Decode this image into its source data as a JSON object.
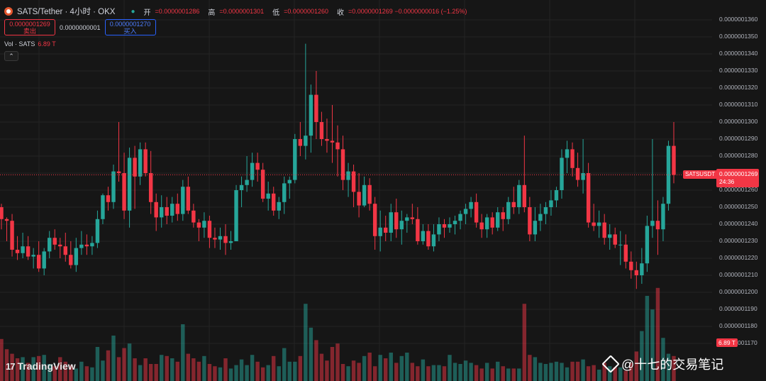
{
  "header": {
    "symbol_title": "SATS/Tether · 4小时 · OKX",
    "live_icon": "circle-dot-icon",
    "ohlc": [
      {
        "label": "开",
        "value": "=0.0000001286"
      },
      {
        "label": "高",
        "value": "=0.0000001301"
      },
      {
        "label": "低",
        "value": "=0.0000001260"
      },
      {
        "label": "收",
        "value": "=0.0000001269 −0.0000000016 (−1.25%)"
      }
    ]
  },
  "trade": {
    "sell_price": "0.0000001269",
    "sell_label": "卖出",
    "spread": "0.0000000001",
    "buy_price": "0.0000001270",
    "buy_label": "买入"
  },
  "volume_legend": {
    "label": "Vol · SATS",
    "value": "6.89 T"
  },
  "collapse_icon": "chevron-up-icon",
  "price_tag": {
    "symbol": "SATSUSDT",
    "price": "0.0000001269",
    "countdown": "24:36"
  },
  "volume_tag": "6.89 T",
  "price_axis": {
    "ticks": [
      "0.0000001360",
      "0.0000001350",
      "0.0000001340",
      "0.0000001330",
      "0.0000001320",
      "0.0000001310",
      "0.0000001300",
      "0.0000001290",
      "0.0000001280",
      "0.0000001270",
      "0.0000001260",
      "0.0000001250",
      "0.0000001240",
      "0.0000001230",
      "0.0000001220",
      "0.0000001210",
      "0.0000001200",
      "0.0000001190",
      "0.0000001180",
      "0.0000001170"
    ]
  },
  "branding": {
    "tv_logo": "TradingView",
    "watermark": "@十七的交易笔记"
  },
  "colors": {
    "up": "#26a69a",
    "down": "#f23645",
    "bg": "#161616",
    "grid": "#242424"
  },
  "chart_data": {
    "type": "candlestick",
    "ylim": [
      1.165,
      1.365
    ],
    "y_unit": "1e-7",
    "candles": [
      [
        1.25,
        1.252,
        1.237,
        1.243
      ],
      [
        1.243,
        1.244,
        1.23,
        1.242
      ],
      [
        1.242,
        1.246,
        1.221,
        1.225
      ],
      [
        1.225,
        1.233,
        1.219,
        1.223
      ],
      [
        1.223,
        1.235,
        1.22,
        1.227
      ],
      [
        1.227,
        1.233,
        1.219,
        1.221
      ],
      [
        1.221,
        1.226,
        1.214,
        1.222
      ],
      [
        1.222,
        1.23,
        1.212,
        1.214
      ],
      [
        1.214,
        1.226,
        1.21,
        1.224
      ],
      [
        1.224,
        1.236,
        1.22,
        1.232
      ],
      [
        1.232,
        1.237,
        1.225,
        1.228
      ],
      [
        1.228,
        1.232,
        1.22,
        1.227
      ],
      [
        1.227,
        1.235,
        1.218,
        1.222
      ],
      [
        1.222,
        1.23,
        1.214,
        1.216
      ],
      [
        1.216,
        1.232,
        1.212,
        1.226
      ],
      [
        1.226,
        1.236,
        1.222,
        1.228
      ],
      [
        1.228,
        1.234,
        1.222,
        1.227
      ],
      [
        1.227,
        1.233,
        1.222,
        1.229
      ],
      [
        1.229,
        1.248,
        1.226,
        1.243
      ],
      [
        1.243,
        1.258,
        1.24,
        1.257
      ],
      [
        1.257,
        1.262,
        1.248,
        1.253
      ],
      [
        1.253,
        1.275,
        1.249,
        1.271
      ],
      [
        1.271,
        1.3,
        1.265,
        1.27
      ],
      [
        1.27,
        1.282,
        1.243,
        1.248
      ],
      [
        1.248,
        1.285,
        1.238,
        1.279
      ],
      [
        1.279,
        1.286,
        1.249,
        1.268
      ],
      [
        1.268,
        1.288,
        1.263,
        1.284
      ],
      [
        1.284,
        1.288,
        1.268,
        1.27
      ],
      [
        1.27,
        1.283,
        1.246,
        1.253
      ],
      [
        1.253,
        1.258,
        1.236,
        1.244
      ],
      [
        1.244,
        1.257,
        1.238,
        1.25
      ],
      [
        1.25,
        1.256,
        1.24,
        1.245
      ],
      [
        1.245,
        1.256,
        1.241,
        1.252
      ],
      [
        1.252,
        1.258,
        1.242,
        1.246
      ],
      [
        1.246,
        1.266,
        1.242,
        1.262
      ],
      [
        1.262,
        1.268,
        1.246,
        1.248
      ],
      [
        1.248,
        1.252,
        1.238,
        1.241
      ],
      [
        1.241,
        1.243,
        1.23,
        1.238
      ],
      [
        1.238,
        1.247,
        1.232,
        1.242
      ],
      [
        1.242,
        1.245,
        1.226,
        1.232
      ],
      [
        1.232,
        1.238,
        1.226,
        1.231
      ],
      [
        1.231,
        1.238,
        1.225,
        1.233
      ],
      [
        1.233,
        1.24,
        1.222,
        1.229
      ],
      [
        1.229,
        1.236,
        1.225,
        1.23
      ],
      [
        1.23,
        1.263,
        1.23,
        1.26
      ],
      [
        1.26,
        1.268,
        1.25,
        1.263
      ],
      [
        1.263,
        1.28,
        1.259,
        1.266
      ],
      [
        1.266,
        1.282,
        1.262,
        1.276
      ],
      [
        1.276,
        1.282,
        1.265,
        1.272
      ],
      [
        1.272,
        1.276,
        1.253,
        1.255
      ],
      [
        1.255,
        1.265,
        1.248,
        1.258
      ],
      [
        1.258,
        1.262,
        1.245,
        1.248
      ],
      [
        1.248,
        1.256,
        1.243,
        1.253
      ],
      [
        1.253,
        1.268,
        1.246,
        1.264
      ],
      [
        1.264,
        1.268,
        1.255,
        1.266
      ],
      [
        1.266,
        1.293,
        1.264,
        1.29
      ],
      [
        1.29,
        1.3,
        1.28,
        1.286
      ],
      [
        1.286,
        1.346,
        1.278,
        1.292
      ],
      [
        1.292,
        1.322,
        1.282,
        1.316
      ],
      [
        1.316,
        1.33,
        1.29,
        1.3
      ],
      [
        1.3,
        1.306,
        1.286,
        1.29
      ],
      [
        1.29,
        1.302,
        1.282,
        1.289
      ],
      [
        1.289,
        1.31,
        1.276,
        1.288
      ],
      [
        1.288,
        1.298,
        1.268,
        1.284
      ],
      [
        1.284,
        1.292,
        1.26,
        1.266
      ],
      [
        1.266,
        1.276,
        1.256,
        1.271
      ],
      [
        1.271,
        1.275,
        1.25,
        1.259
      ],
      [
        1.259,
        1.27,
        1.244,
        1.251
      ],
      [
        1.251,
        1.268,
        1.25,
        1.263
      ],
      [
        1.263,
        1.267,
        1.248,
        1.252
      ],
      [
        1.252,
        1.256,
        1.225,
        1.233
      ],
      [
        1.233,
        1.248,
        1.224,
        1.238
      ],
      [
        1.238,
        1.245,
        1.23,
        1.235
      ],
      [
        1.235,
        1.252,
        1.23,
        1.247
      ],
      [
        1.247,
        1.255,
        1.232,
        1.237
      ],
      [
        1.237,
        1.248,
        1.228,
        1.242
      ],
      [
        1.242,
        1.246,
        1.235,
        1.244
      ],
      [
        1.244,
        1.252,
        1.24,
        1.243
      ],
      [
        1.243,
        1.25,
        1.228,
        1.23
      ],
      [
        1.23,
        1.24,
        1.228,
        1.236
      ],
      [
        1.236,
        1.24,
        1.225,
        1.227
      ],
      [
        1.227,
        1.24,
        1.224,
        1.234
      ],
      [
        1.234,
        1.244,
        1.23,
        1.24
      ],
      [
        1.24,
        1.243,
        1.232,
        1.238
      ],
      [
        1.238,
        1.244,
        1.235,
        1.24
      ],
      [
        1.24,
        1.245,
        1.234,
        1.242
      ],
      [
        1.242,
        1.248,
        1.237,
        1.246
      ],
      [
        1.246,
        1.252,
        1.24,
        1.249
      ],
      [
        1.249,
        1.256,
        1.244,
        1.253
      ],
      [
        1.253,
        1.258,
        1.238,
        1.241
      ],
      [
        1.241,
        1.246,
        1.232,
        1.237
      ],
      [
        1.237,
        1.246,
        1.232,
        1.244
      ],
      [
        1.244,
        1.247,
        1.234,
        1.238
      ],
      [
        1.238,
        1.25,
        1.236,
        1.247
      ],
      [
        1.247,
        1.25,
        1.236,
        1.243
      ],
      [
        1.243,
        1.256,
        1.24,
        1.253
      ],
      [
        1.253,
        1.262,
        1.246,
        1.25
      ],
      [
        1.25,
        1.266,
        1.246,
        1.263
      ],
      [
        1.263,
        1.292,
        1.247,
        1.25
      ],
      [
        1.25,
        1.256,
        1.23,
        1.234
      ],
      [
        1.234,
        1.25,
        1.23,
        1.242
      ],
      [
        1.242,
        1.252,
        1.236,
        1.246
      ],
      [
        1.246,
        1.253,
        1.24,
        1.25
      ],
      [
        1.25,
        1.26,
        1.245,
        1.254
      ],
      [
        1.254,
        1.262,
        1.25,
        1.26
      ],
      [
        1.26,
        1.284,
        1.255,
        1.279
      ],
      [
        1.279,
        1.289,
        1.27,
        1.284
      ],
      [
        1.284,
        1.288,
        1.268,
        1.273
      ],
      [
        1.273,
        1.282,
        1.262,
        1.266
      ],
      [
        1.266,
        1.29,
        1.258,
        1.27
      ],
      [
        1.27,
        1.276,
        1.238,
        1.241
      ],
      [
        1.241,
        1.252,
        1.236,
        1.239
      ],
      [
        1.239,
        1.248,
        1.232,
        1.241
      ],
      [
        1.241,
        1.246,
        1.228,
        1.232
      ],
      [
        1.232,
        1.24,
        1.225,
        1.234
      ],
      [
        1.234,
        1.238,
        1.226,
        1.228
      ],
      [
        1.228,
        1.236,
        1.216,
        1.228
      ],
      [
        1.228,
        1.234,
        1.214,
        1.218
      ],
      [
        1.218,
        1.224,
        1.208,
        1.213
      ],
      [
        1.213,
        1.218,
        1.202,
        1.21
      ],
      [
        1.21,
        1.226,
        1.205,
        1.217
      ],
      [
        1.217,
        1.245,
        1.212,
        1.239
      ],
      [
        1.239,
        1.29,
        1.232,
        1.242
      ],
      [
        1.242,
        1.254,
        1.222,
        1.237
      ],
      [
        1.237,
        1.256,
        1.23,
        1.252
      ],
      [
        1.252,
        1.289,
        1.248,
        1.286
      ],
      [
        1.286,
        1.3,
        1.264,
        1.269
      ]
    ],
    "volume_max": 1.0,
    "volumes": [
      0.37,
      0.28,
      0.24,
      0.2,
      0.21,
      0.16,
      0.21,
      0.22,
      0.23,
      0.15,
      0.13,
      0.21,
      0.17,
      0.14,
      0.11,
      0.17,
      0.13,
      0.12,
      0.3,
      0.18,
      0.27,
      0.4,
      0.21,
      0.29,
      0.33,
      0.2,
      0.14,
      0.2,
      0.15,
      0.15,
      0.23,
      0.22,
      0.2,
      0.17,
      0.5,
      0.24,
      0.2,
      0.17,
      0.22,
      0.15,
      0.13,
      0.12,
      0.2,
      0.11,
      0.14,
      0.19,
      0.14,
      0.23,
      0.17,
      0.12,
      0.14,
      0.22,
      0.13,
      0.29,
      0.17,
      0.17,
      0.22,
      0.68,
      0.47,
      0.36,
      0.24,
      0.18,
      0.3,
      0.33,
      0.15,
      0.13,
      0.18,
      0.16,
      0.22,
      0.25,
      0.13,
      0.23,
      0.2,
      0.25,
      0.16,
      0.22,
      0.25,
      0.16,
      0.13,
      0.19,
      0.13,
      0.14,
      0.14,
      0.13,
      0.23,
      0.16,
      0.15,
      0.18,
      0.16,
      0.14,
      0.11,
      0.16,
      0.11,
      0.17,
      0.13,
      0.11,
      0.11,
      0.11,
      0.68,
      0.23,
      0.21,
      0.16,
      0.15,
      0.16,
      0.17,
      0.16,
      0.12,
      0.17,
      0.17,
      0.19,
      0.13,
      0.14,
      0.1,
      0.16,
      0.13,
      0.12,
      0.12,
      0.09,
      0.16,
      0.26,
      0.44,
      0.75,
      0.63,
      0.82,
      0.38,
      0.24,
      0.22,
      0.29,
      0.33
    ]
  }
}
